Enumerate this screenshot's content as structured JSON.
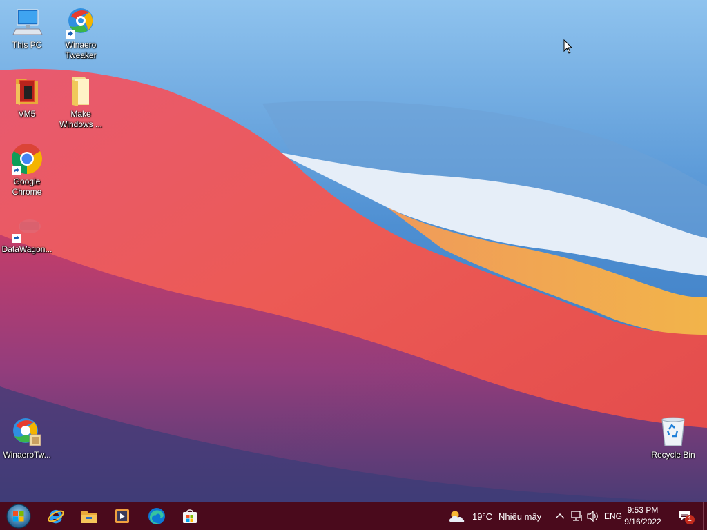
{
  "desktop": {
    "icons": [
      {
        "name": "this-pc",
        "label_lines": [
          "This PC"
        ],
        "shortcut": false
      },
      {
        "name": "winaero-tweaker",
        "label_lines": [
          "Winaero",
          "Tweaker"
        ],
        "shortcut": true
      },
      {
        "name": "vm5",
        "label_lines": [
          "VM5"
        ],
        "shortcut": false
      },
      {
        "name": "make-windows",
        "label_lines": [
          "Make",
          "Windows ..."
        ],
        "shortcut": false
      },
      {
        "name": "google-chrome",
        "label_lines": [
          "Google",
          "Chrome"
        ],
        "shortcut": true
      },
      {
        "name": "datawagon",
        "label_lines": [
          "DataWagon..."
        ],
        "shortcut": true
      },
      {
        "name": "winaerotw",
        "label_lines": [
          "WinaeroTw..."
        ],
        "shortcut": false
      },
      {
        "name": "recycle-bin",
        "label_lines": [
          "Recycle Bin"
        ],
        "shortcut": false
      }
    ]
  },
  "taskbar": {
    "color": "#4a0a1c",
    "pinned": [
      "start-orb",
      "internet-explorer",
      "file-explorer",
      "media-player",
      "edge",
      "microsoft-store"
    ],
    "weather": {
      "temp": "19°C",
      "condition": "Nhiều mây"
    },
    "tray": {
      "language": "ENG",
      "time": "9:53 PM",
      "date": "9/16/2022",
      "notification_count": "1"
    }
  }
}
